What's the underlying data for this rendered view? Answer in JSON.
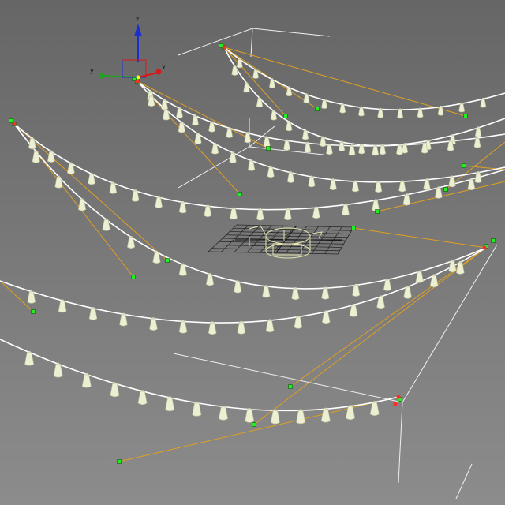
{
  "viewport": {
    "name": "perspective-viewport",
    "background_top": "#666666",
    "background_bottom": "#8c8c8c"
  },
  "gizmo": {
    "x_label": "x",
    "y_label": "y",
    "z_label": "z",
    "x_color": "#d81818",
    "y_color": "#20a020",
    "z_color": "#1a2fd0"
  },
  "colors": {
    "wire": "#ffffff",
    "bulb": "#ecefd2",
    "bulb_shade": "#b8bb98",
    "target_line": "#e0a020",
    "handle": "#22ee22",
    "grid": "#262626",
    "helper": "#e6e6b0",
    "selected_vertex": "#ff2a2a"
  },
  "icons": [
    "move-gizmo-icon",
    "camera-frustum-icon",
    "light-target-icon",
    "grid-icon"
  ]
}
